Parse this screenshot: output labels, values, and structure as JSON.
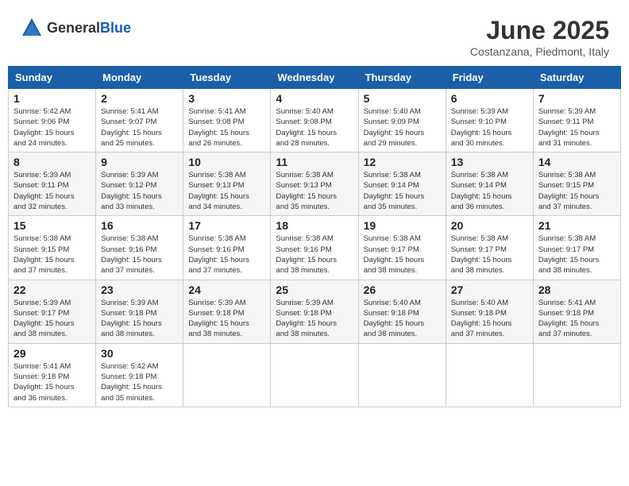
{
  "logo": {
    "general": "General",
    "blue": "Blue"
  },
  "title": {
    "month_year": "June 2025",
    "location": "Costanzana, Piedmont, Italy"
  },
  "weekdays": [
    "Sunday",
    "Monday",
    "Tuesday",
    "Wednesday",
    "Thursday",
    "Friday",
    "Saturday"
  ],
  "weeks": [
    [
      {
        "day": "1",
        "sunrise": "5:42 AM",
        "sunset": "9:06 PM",
        "daylight": "15 hours and 24 minutes."
      },
      {
        "day": "2",
        "sunrise": "5:41 AM",
        "sunset": "9:07 PM",
        "daylight": "15 hours and 25 minutes."
      },
      {
        "day": "3",
        "sunrise": "5:41 AM",
        "sunset": "9:08 PM",
        "daylight": "15 hours and 26 minutes."
      },
      {
        "day": "4",
        "sunrise": "5:40 AM",
        "sunset": "9:08 PM",
        "daylight": "15 hours and 28 minutes."
      },
      {
        "day": "5",
        "sunrise": "5:40 AM",
        "sunset": "9:09 PM",
        "daylight": "15 hours and 29 minutes."
      },
      {
        "day": "6",
        "sunrise": "5:39 AM",
        "sunset": "9:10 PM",
        "daylight": "15 hours and 30 minutes."
      },
      {
        "day": "7",
        "sunrise": "5:39 AM",
        "sunset": "9:11 PM",
        "daylight": "15 hours and 31 minutes."
      }
    ],
    [
      {
        "day": "8",
        "sunrise": "5:39 AM",
        "sunset": "9:11 PM",
        "daylight": "15 hours and 32 minutes."
      },
      {
        "day": "9",
        "sunrise": "5:39 AM",
        "sunset": "9:12 PM",
        "daylight": "15 hours and 33 minutes."
      },
      {
        "day": "10",
        "sunrise": "5:38 AM",
        "sunset": "9:13 PM",
        "daylight": "15 hours and 34 minutes."
      },
      {
        "day": "11",
        "sunrise": "5:38 AM",
        "sunset": "9:13 PM",
        "daylight": "15 hours and 35 minutes."
      },
      {
        "day": "12",
        "sunrise": "5:38 AM",
        "sunset": "9:14 PM",
        "daylight": "15 hours and 35 minutes."
      },
      {
        "day": "13",
        "sunrise": "5:38 AM",
        "sunset": "9:14 PM",
        "daylight": "15 hours and 36 minutes."
      },
      {
        "day": "14",
        "sunrise": "5:38 AM",
        "sunset": "9:15 PM",
        "daylight": "15 hours and 37 minutes."
      }
    ],
    [
      {
        "day": "15",
        "sunrise": "5:38 AM",
        "sunset": "9:15 PM",
        "daylight": "15 hours and 37 minutes."
      },
      {
        "day": "16",
        "sunrise": "5:38 AM",
        "sunset": "9:16 PM",
        "daylight": "15 hours and 37 minutes."
      },
      {
        "day": "17",
        "sunrise": "5:38 AM",
        "sunset": "9:16 PM",
        "daylight": "15 hours and 37 minutes."
      },
      {
        "day": "18",
        "sunrise": "5:38 AM",
        "sunset": "9:16 PM",
        "daylight": "15 hours and 38 minutes."
      },
      {
        "day": "19",
        "sunrise": "5:38 AM",
        "sunset": "9:17 PM",
        "daylight": "15 hours and 38 minutes."
      },
      {
        "day": "20",
        "sunrise": "5:38 AM",
        "sunset": "9:17 PM",
        "daylight": "15 hours and 38 minutes."
      },
      {
        "day": "21",
        "sunrise": "5:38 AM",
        "sunset": "9:17 PM",
        "daylight": "15 hours and 38 minutes."
      }
    ],
    [
      {
        "day": "22",
        "sunrise": "5:39 AM",
        "sunset": "9:17 PM",
        "daylight": "15 hours and 38 minutes."
      },
      {
        "day": "23",
        "sunrise": "5:39 AM",
        "sunset": "9:18 PM",
        "daylight": "15 hours and 38 minutes."
      },
      {
        "day": "24",
        "sunrise": "5:39 AM",
        "sunset": "9:18 PM",
        "daylight": "15 hours and 38 minutes."
      },
      {
        "day": "25",
        "sunrise": "5:39 AM",
        "sunset": "9:18 PM",
        "daylight": "15 hours and 38 minutes."
      },
      {
        "day": "26",
        "sunrise": "5:40 AM",
        "sunset": "9:18 PM",
        "daylight": "15 hours and 38 minutes."
      },
      {
        "day": "27",
        "sunrise": "5:40 AM",
        "sunset": "9:18 PM",
        "daylight": "15 hours and 37 minutes."
      },
      {
        "day": "28",
        "sunrise": "5:41 AM",
        "sunset": "9:18 PM",
        "daylight": "15 hours and 37 minutes."
      }
    ],
    [
      {
        "day": "29",
        "sunrise": "5:41 AM",
        "sunset": "9:18 PM",
        "daylight": "15 hours and 36 minutes."
      },
      {
        "day": "30",
        "sunrise": "5:42 AM",
        "sunset": "9:18 PM",
        "daylight": "15 hours and 35 minutes."
      },
      null,
      null,
      null,
      null,
      null
    ]
  ]
}
